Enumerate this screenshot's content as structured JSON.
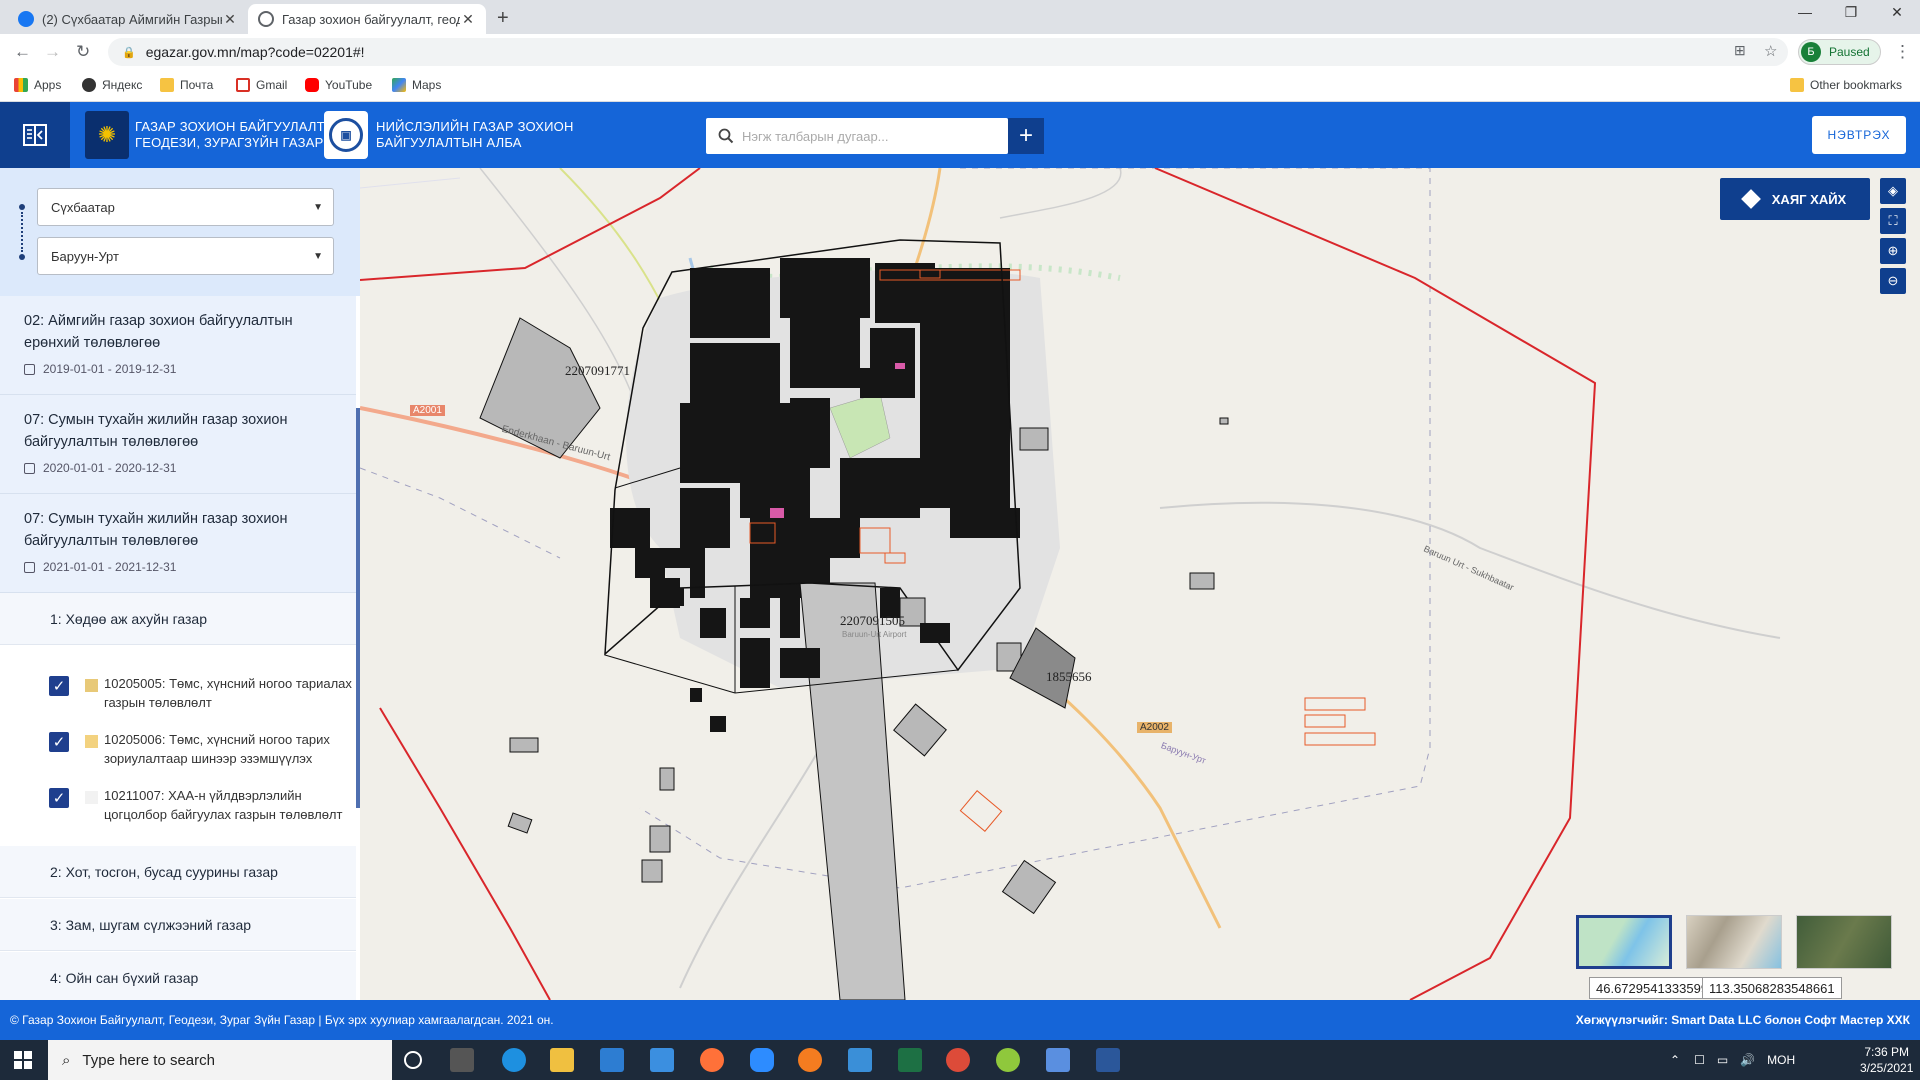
{
  "browser": {
    "tabs": [
      {
        "title": "(2) Сүхбаатар Аймгийн Газрын Х",
        "active": false
      },
      {
        "title": "Газар зохион байгуулалт, геоде",
        "active": true
      }
    ],
    "url": "egazar.gov.mn/map?code=02201#!",
    "profile_initial": "Б",
    "profile_status": "Paused",
    "bookmarks": [
      "Apps",
      "Яндекс",
      "Почта",
      "Gmail",
      "YouTube",
      "Maps"
    ],
    "other_bookmarks": "Other bookmarks"
  },
  "header": {
    "org1_line1": "ГАЗАР ЗОХИОН БАЙГУУЛАЛТ,",
    "org1_line2": "ГЕОДЕЗИ, ЗУРАГЗҮЙН ГАЗАР",
    "org2_line1": "НИЙСЛЭЛИЙН ГАЗАР ЗОХИОН",
    "org2_line2": "БАЙГУУЛАЛТЫН АЛБА",
    "search_placeholder": "Нэгж талбарын дугаар...",
    "login_label": "НЭВТРЭХ"
  },
  "sidebar": {
    "province": "Сүхбаатар",
    "soum": "Баруун-Урт",
    "plans": [
      {
        "title": "02: Аймгийн газар зохион байгуулалтын ерөнхий төлөвлөгөө",
        "dates": "2019-01-01 - 2019-12-31"
      },
      {
        "title": "07: Сумын тухайн жилийн газар зохион байгуулалтын төлөвлөгөө",
        "dates": "2020-01-01 - 2020-12-31"
      },
      {
        "title": "07: Сумын тухайн жилийн газар зохион байгуулалтын төлөвлөгөө",
        "dates": "2021-01-01 - 2021-12-31"
      }
    ],
    "categories": [
      "1: Хөдөө аж ахуйн газар",
      "2: Хот, тосгон, бусад суурины газар",
      "3: Зам, шугам сүлжээний газар",
      "4: Ойн сан бүхий газар"
    ],
    "layers": [
      {
        "label": "10205005: Төмс, хүнсний ногоо тариалах газрын төлөвлөлт",
        "color": "#e8c978",
        "checked": true
      },
      {
        "label": "10205006: Төмс, хүнсний ногоо тарих зориулалтаар шинээр эзэмшүүлэх",
        "color": "#f3d27f",
        "checked": true
      },
      {
        "label": "10211007: ХАА-н үйлдвэрлэлийн цогцолбор байгуулах газрын төлөвлөлт",
        "color": "#f2f2f2",
        "checked": true
      }
    ]
  },
  "map": {
    "find_address_label": "ХАЯГ ХАЙХ",
    "parcel_labels": [
      "2207091771",
      "2207091505",
      "1855656"
    ],
    "road_labels": [
      "A2001",
      "A2002",
      "Enderkhaan - Baruun-Urt",
      "Baruun Urt - Sukhbaatar",
      "Баруун-Урт"
    ],
    "airport_label": "Baruun-Urt Airport",
    "latitude": "46.67295413335992",
    "longitude": "113.35068283548661"
  },
  "footer": {
    "copyright": "© Газар Зохион Байгуулалт, Геодези, Зураг Зүйн Газар | Бүх эрх хуулиар хамгаалагдсан. 2021 он.",
    "developer": "Хөгжүүлэгчийг: Smart Data LLC болон Софт Мастер ХХК"
  },
  "taskbar": {
    "search_placeholder": "Type here to search",
    "lang": "МОН",
    "time": "7:36 PM",
    "date": "3/25/2021"
  }
}
